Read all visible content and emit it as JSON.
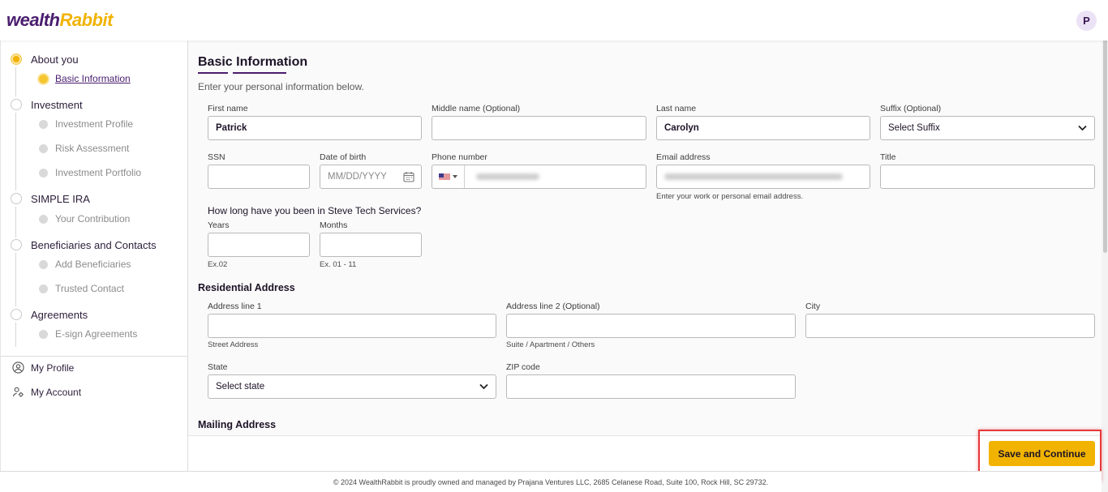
{
  "brand": {
    "logo_text_a": "wealth",
    "logo_text_b": "Rabbit",
    "avatar_initial": "P",
    "accent": "#f1b300",
    "brand_color": "#4a1d6e"
  },
  "sidebar": {
    "steps": [
      {
        "label": "About you",
        "substeps": [
          "Basic Information"
        ]
      },
      {
        "label": "Investment",
        "substeps": [
          "Investment Profile",
          "Risk Assessment",
          "Investment Portfolio"
        ]
      },
      {
        "label": "SIMPLE IRA",
        "substeps": [
          "Your Contribution"
        ]
      },
      {
        "label": "Beneficiaries and Contacts",
        "substeps": [
          "Add Beneficiaries",
          "Trusted Contact"
        ]
      },
      {
        "label": "Agreements",
        "substeps": [
          "E-sign Agreements"
        ]
      }
    ],
    "links": {
      "profile": "My Profile",
      "account": "My Account"
    }
  },
  "form": {
    "title": "Basic Information",
    "subtitle": "Enter your personal information below.",
    "first_name": {
      "label": "First name",
      "value": "Patrick"
    },
    "middle_name": {
      "label": "Middle name (Optional)",
      "value": ""
    },
    "last_name": {
      "label": "Last name",
      "value": "Carolyn"
    },
    "suffix": {
      "label": "Suffix (Optional)",
      "value": "Select Suffix"
    },
    "ssn": {
      "label": "SSN",
      "value": ""
    },
    "dob": {
      "label": "Date of birth",
      "placeholder": "MM/DD/YYYY"
    },
    "phone": {
      "label": "Phone number",
      "country": "US"
    },
    "email": {
      "label": "Email address",
      "hint": "Enter your work or personal email address."
    },
    "job_title": {
      "label": "Title",
      "value": ""
    },
    "tenure_question": "How long have you been in Steve Tech Services?",
    "years": {
      "label": "Years",
      "hint": "Ex.02"
    },
    "months": {
      "label": "Months",
      "hint": "Ex. 01 - 11"
    }
  },
  "residential": {
    "heading": "Residential Address",
    "address1": {
      "label": "Address line 1",
      "hint": "Street Address"
    },
    "address2": {
      "label": "Address line 2 (Optional)",
      "hint": "Suite / Apartment / Others"
    },
    "city": {
      "label": "City"
    },
    "state": {
      "label": "State",
      "value": "Select state"
    },
    "zip": {
      "label": "ZIP code"
    }
  },
  "mailing": {
    "heading": "Mailing Address"
  },
  "actions": {
    "save": "Save and Continue"
  },
  "footer": {
    "text": "© 2024 WealthRabbit is proudly owned and managed by Prajana Ventures LLC, 2685 Celanese Road, Suite 100, Rock Hill, SC 29732."
  }
}
